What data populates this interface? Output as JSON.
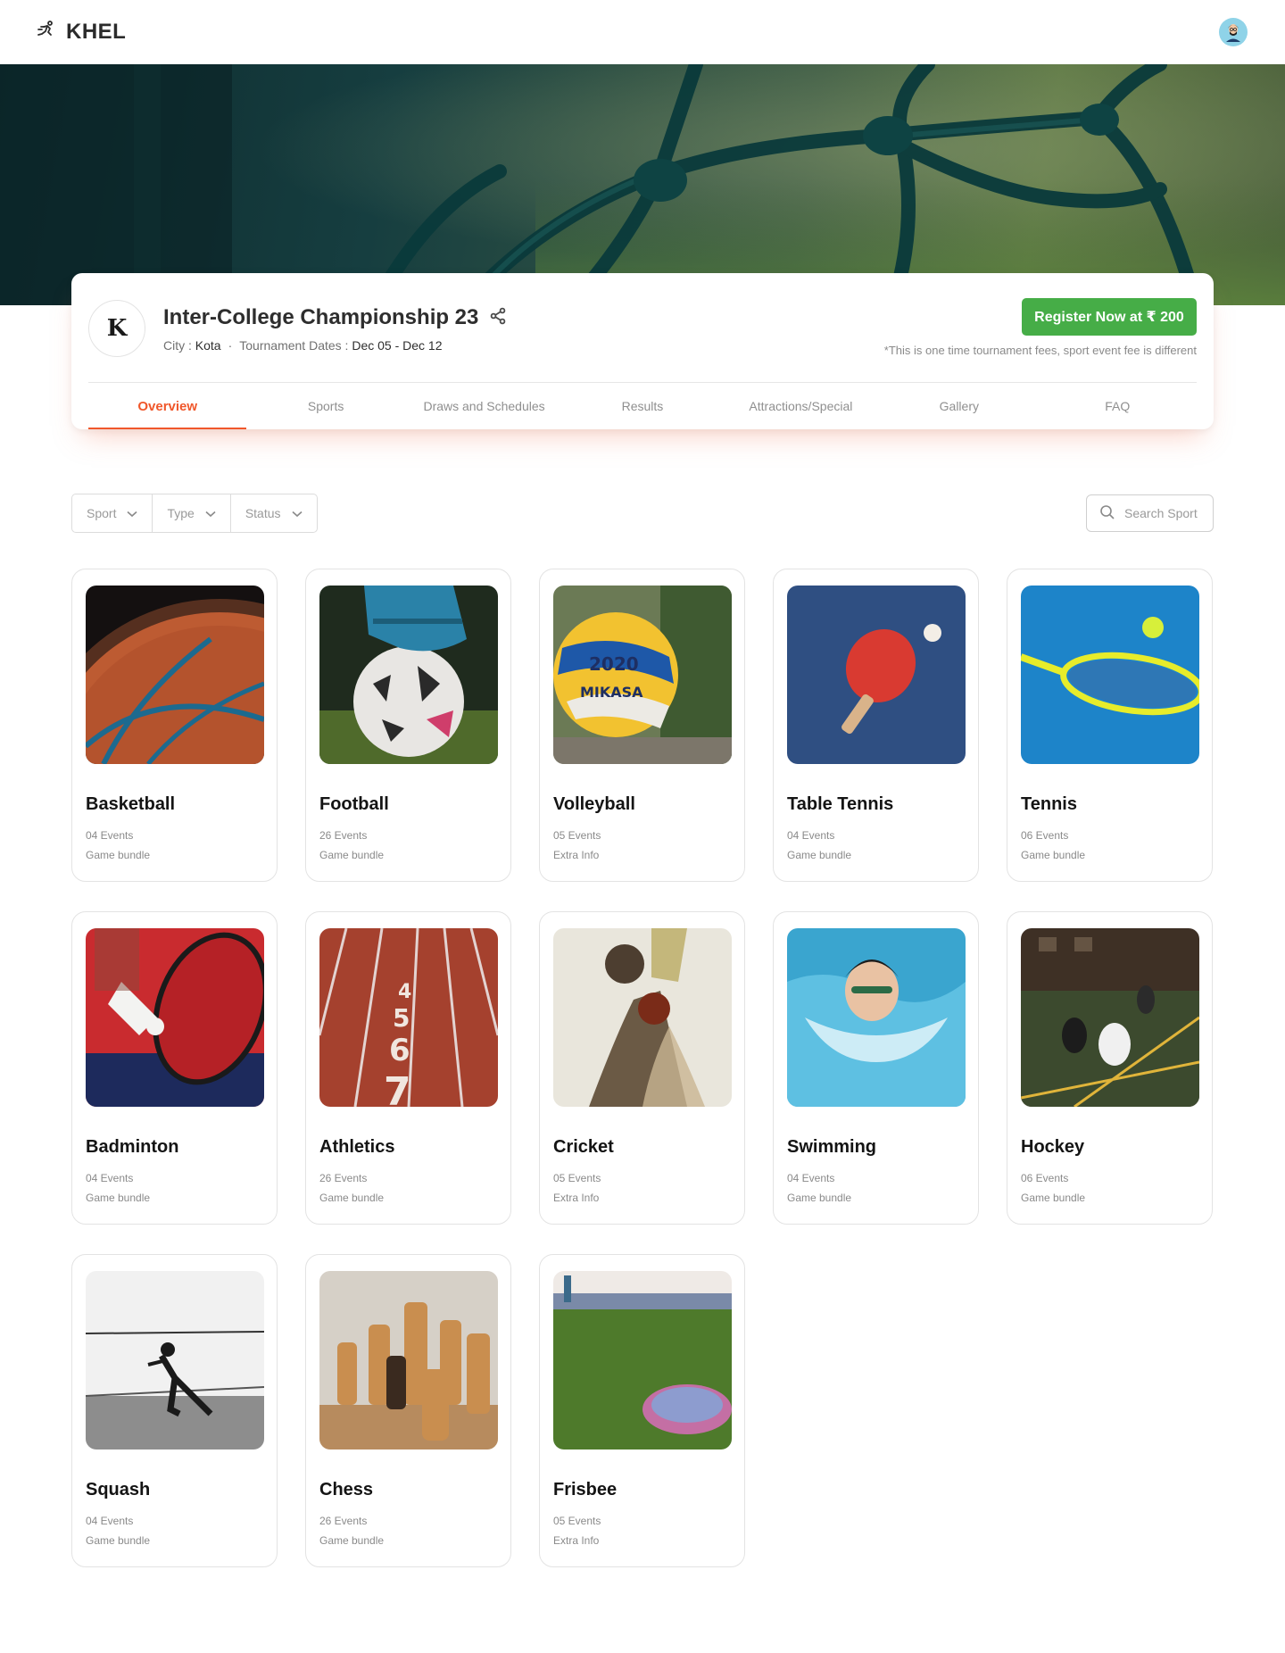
{
  "header": {
    "brand": "KHEL"
  },
  "tournament": {
    "logo_letter": "K",
    "title": "Inter-College Championship 23",
    "city_label": "City : ",
    "city": "Kota",
    "dates_label": "Tournament Dates : ",
    "dates": "Dec 05 - Dec 12",
    "register_label": "Register Now at ₹ 200",
    "fee_note": "*This is one time tournament fees, sport event fee is different"
  },
  "tabs": [
    {
      "label": "Overview",
      "active": true
    },
    {
      "label": "Sports"
    },
    {
      "label": "Draws and Schedules"
    },
    {
      "label": "Results"
    },
    {
      "label": "Attractions/Special"
    },
    {
      "label": "Gallery"
    },
    {
      "label": "FAQ"
    }
  ],
  "filters": {
    "sport": "Sport",
    "type": "Type",
    "status": "Status"
  },
  "search": {
    "placeholder": "Search Sport"
  },
  "colors": {
    "accent": "#f0572b",
    "register": "#46ad47"
  },
  "sports": [
    {
      "name": "Basketball",
      "events": "04 Events",
      "extra": "Game bundle"
    },
    {
      "name": "Football",
      "events": "26 Events",
      "extra": "Game bundle"
    },
    {
      "name": "Volleyball",
      "events": "05 Events",
      "extra": "Extra Info"
    },
    {
      "name": "Table Tennis",
      "events": "04 Events",
      "extra": "Game bundle"
    },
    {
      "name": "Tennis",
      "events": "06 Events",
      "extra": "Game bundle"
    },
    {
      "name": "Badminton",
      "events": "04 Events",
      "extra": "Game bundle"
    },
    {
      "name": "Athletics",
      "events": "26 Events",
      "extra": "Game bundle"
    },
    {
      "name": "Cricket",
      "events": "05 Events",
      "extra": "Extra Info"
    },
    {
      "name": "Swimming",
      "events": "04 Events",
      "extra": "Game bundle"
    },
    {
      "name": "Hockey",
      "events": "06 Events",
      "extra": "Game bundle"
    },
    {
      "name": "Squash",
      "events": "04 Events",
      "extra": "Game bundle"
    },
    {
      "name": "Chess",
      "events": "26 Events",
      "extra": "Game bundle"
    },
    {
      "name": "Frisbee",
      "events": "05 Events",
      "extra": "Extra Info"
    }
  ]
}
